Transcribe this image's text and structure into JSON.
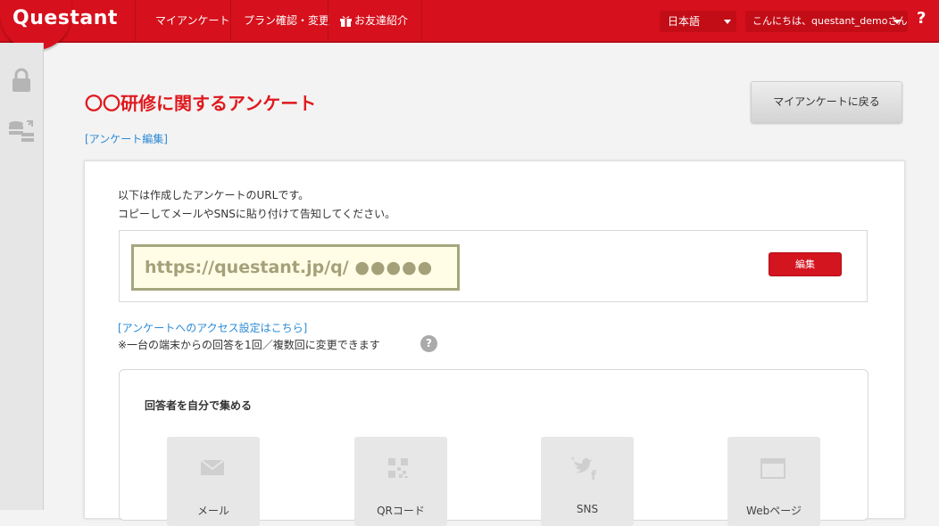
{
  "header": {
    "logo": "Questant",
    "nav": [
      "マイアンケート",
      "プラン確認・変更",
      "お友達紹介"
    ],
    "language": "日本語",
    "greeting": "こんにちは、questant_demoさん",
    "help": "?"
  },
  "sidebar": {
    "icons": [
      "lock-icon",
      "database-transfer-icon"
    ]
  },
  "main": {
    "title": "〇〇研修に関するアンケート",
    "edit_link": "[アンケート編集]",
    "back_button": "マイアンケートに戻る",
    "desc_line1": "以下は作成したアンケートのURLです。",
    "desc_line2": "コピーしてメールやSNSに貼り付けて告知してください。",
    "url_text": "https://questant.jp/q/",
    "url_mask": "●●●●●",
    "edit_button": "編集",
    "access_link": "[アンケートへのアクセス設定はこちら]",
    "note": "※一台の端末からの回答を1回／複数回に変更できます",
    "collect_title": "回答者を自分で集める",
    "tiles": [
      "メール",
      "QRコード",
      "SNS",
      "Webページ"
    ]
  },
  "colors": {
    "brand": "#d6101c",
    "link": "#2a8ad6",
    "title": "#e0191e"
  }
}
